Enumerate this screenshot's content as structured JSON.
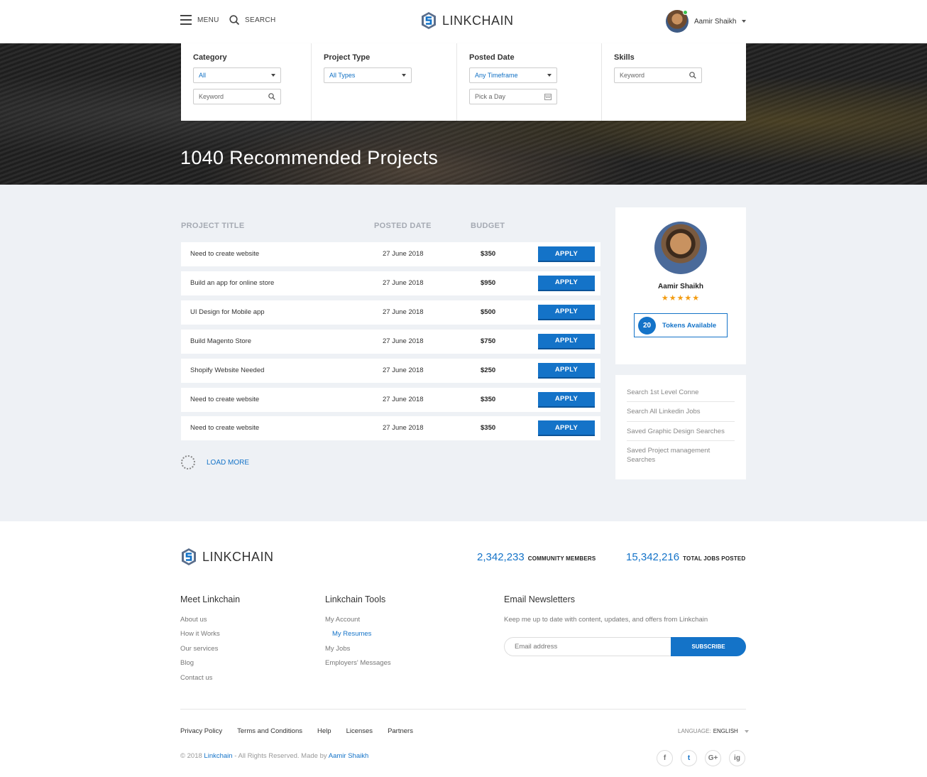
{
  "header": {
    "menu_label": "MENU",
    "search_label": "SEARCH",
    "brand": "LINKCHAIN",
    "user_name": "Aamir Shaikh"
  },
  "filters": {
    "category": {
      "title": "Category",
      "value": "All",
      "keyword_placeholder": "Keyword"
    },
    "project_type": {
      "title": "Project Type",
      "value": "All Types"
    },
    "posted_date": {
      "title": "Posted Date",
      "value": "Any Timeframe",
      "day_placeholder": "Pick a Day"
    },
    "skills": {
      "title": "Skills",
      "keyword_placeholder": "Keyword"
    }
  },
  "hero": {
    "title": "1040 Recommended Projects"
  },
  "table": {
    "headers": {
      "title": "PROJECT TITLE",
      "date": "POSTED DATE",
      "budget": "BUDGET"
    },
    "apply_label": "APPLY",
    "rows": [
      {
        "title": "Need to create website",
        "date": "27 June 2018",
        "budget": "$350"
      },
      {
        "title": "Build an app for online store",
        "date": "27 June 2018",
        "budget": "$950"
      },
      {
        "title": "UI Design for Mobile app",
        "date": "27 June 2018",
        "budget": "$500"
      },
      {
        "title": "Build Magento Store",
        "date": "27 June 2018",
        "budget": "$750"
      },
      {
        "title": "Shopify Website Needed",
        "date": "27 June 2018",
        "budget": "$250"
      },
      {
        "title": "Need to create website",
        "date": "27 June 2018",
        "budget": "$350"
      },
      {
        "title": "Need to create website",
        "date": "27 June 2018",
        "budget": "$350"
      }
    ],
    "load_more": "LOAD MORE"
  },
  "profile": {
    "name": "Aamir Shaikh",
    "stars": "★★★★★",
    "tokens_count": "20",
    "tokens_label": "Tokens Available"
  },
  "saved_searches": [
    "Search 1st Level Conne",
    "Search All Linkedin Jobs",
    "Saved Graphic Design Searches",
    "Saved Project management Searches"
  ],
  "footer": {
    "brand": "LINKCHAIN",
    "members_count": "2,342,233",
    "members_label": "COMMUNITY MEMBERS",
    "jobs_count": "15,342,216",
    "jobs_label": "TOTAL JOBS POSTED",
    "meet": {
      "title": "Meet Linkchain",
      "links": [
        "About us",
        "How it Works",
        "Our services",
        "Blog",
        "Contact us"
      ]
    },
    "tools": {
      "title": "Linkchain Tools",
      "links": [
        "My Account",
        "My Resumes",
        "My Jobs",
        "Employers' Messages"
      ]
    },
    "newsletter": {
      "title": "Email Newsletters",
      "description": "Keep me up to date with content, updates, and offers from Linkchain",
      "email_placeholder": "Email address",
      "subscribe_label": "SUBSCRIBE"
    },
    "legal_links": [
      "Privacy Policy",
      "Terms and Conditions",
      "Help",
      "Licenses",
      "Partners"
    ],
    "language_label": "LANGUAGE:",
    "language_value": "ENGLISH",
    "copyright_prefix": "© 2018",
    "copyright_brand": "Linkchain",
    "copyright_middle": "- All Rights Reserved. Made by",
    "copyright_author": "Aamir Shaikh",
    "social": [
      "f",
      "t",
      "G+",
      "ig"
    ]
  },
  "colors": {
    "accent": "#1473c8",
    "background": "#eef1f5",
    "star": "#f39c12"
  }
}
